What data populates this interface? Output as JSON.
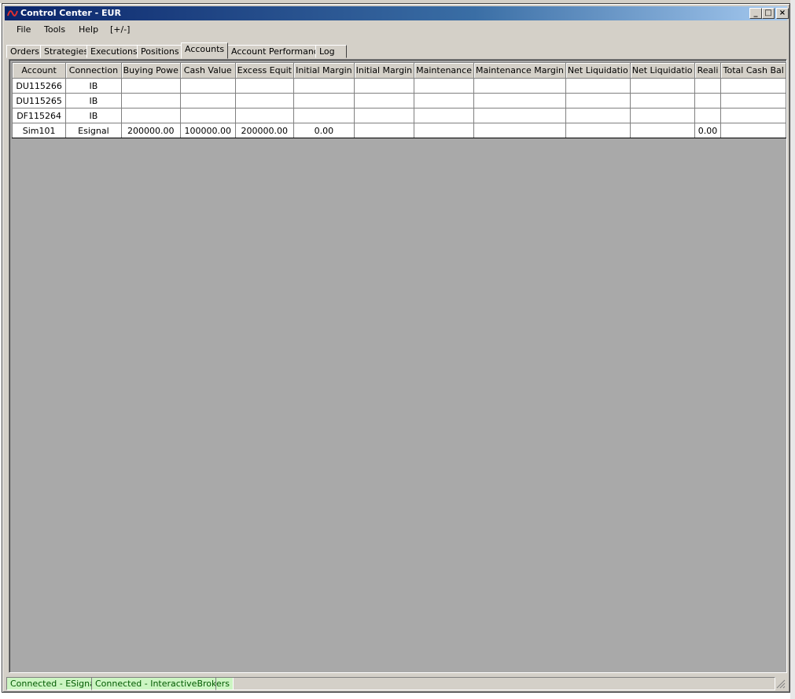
{
  "window": {
    "title": "Control Center - EUR",
    "minimize_glyph": "_",
    "maximize_glyph": "□",
    "close_glyph": "×"
  },
  "menu": [
    "File",
    "Tools",
    "Help",
    "[+/-]"
  ],
  "tabs": [
    {
      "label": "Orders",
      "active": false
    },
    {
      "label": "Strategies",
      "active": false
    },
    {
      "label": "Executions",
      "active": false
    },
    {
      "label": "Positions",
      "active": false
    },
    {
      "label": "Accounts",
      "active": true
    },
    {
      "label": "Account Performance",
      "active": false
    },
    {
      "label": "Log",
      "active": false
    }
  ],
  "accounts_table": {
    "columns": [
      "Account",
      "Connection",
      "Buying Powe",
      "Cash Value",
      "Excess Equit",
      "Initial Margin",
      "Initial Margin",
      "Maintenance",
      "Maintenance Margin",
      "Net Liquidatio",
      "Net Liquidatio",
      "Reali",
      "Total Cash Bal"
    ],
    "rows": [
      [
        "DU115266",
        "IB",
        "",
        "",
        "",
        "",
        "",
        "",
        "",
        "",
        "",
        "",
        ""
      ],
      [
        "DU115265",
        "IB",
        "",
        "",
        "",
        "",
        "",
        "",
        "",
        "",
        "",
        "",
        ""
      ],
      [
        "DF115264",
        "IB",
        "",
        "",
        "",
        "",
        "",
        "",
        "",
        "",
        "",
        "",
        ""
      ],
      [
        "Sim101",
        "Esignal",
        "200000.00",
        "100000.00",
        "200000.00",
        "0.00",
        "",
        "",
        "",
        "",
        "",
        "0.00",
        ""
      ]
    ]
  },
  "status": {
    "esignal": "Connected - ESignal",
    "ib": "Connected - InteractiveBrokers"
  },
  "colors": {
    "titlebar_start": "#0a246a",
    "status_ok_bg": "#ccf5c2",
    "grid_background": "#a9a9a9"
  }
}
